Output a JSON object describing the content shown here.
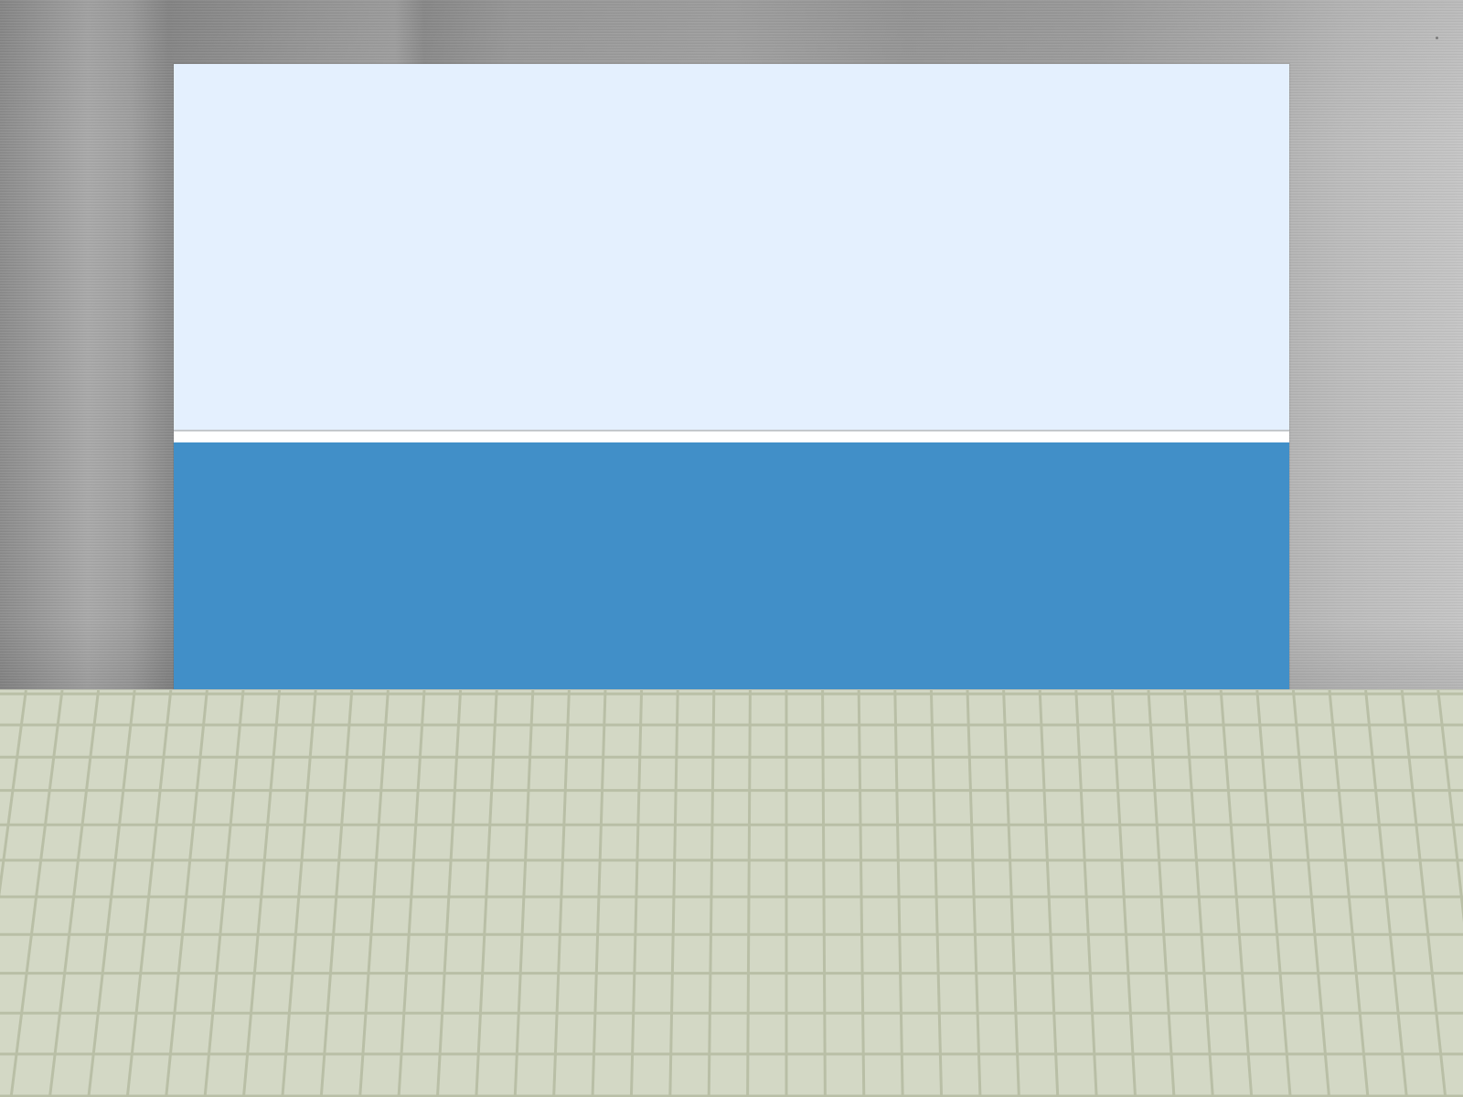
{
  "scene": {
    "wall_color": "#a0a0a0",
    "screen_upper_color": "#e4f0fe",
    "screen_divider_color": "#ffffff",
    "screen_lower_color": "#418fc8",
    "floor_color": "#d3d8c5",
    "floor_grout_color": "#b9bfa6"
  }
}
